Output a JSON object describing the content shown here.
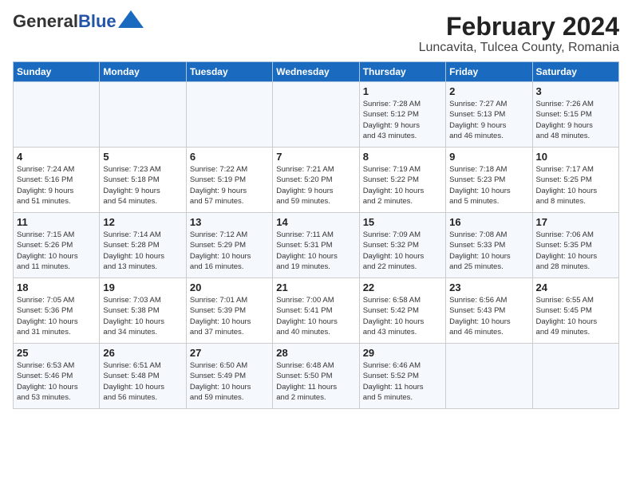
{
  "logo": {
    "general": "General",
    "blue": "Blue"
  },
  "title": "February 2024",
  "subtitle": "Luncavita, Tulcea County, Romania",
  "days_of_week": [
    "Sunday",
    "Monday",
    "Tuesday",
    "Wednesday",
    "Thursday",
    "Friday",
    "Saturday"
  ],
  "weeks": [
    [
      {
        "day": "",
        "info": ""
      },
      {
        "day": "",
        "info": ""
      },
      {
        "day": "",
        "info": ""
      },
      {
        "day": "",
        "info": ""
      },
      {
        "day": "1",
        "info": "Sunrise: 7:28 AM\nSunset: 5:12 PM\nDaylight: 9 hours\nand 43 minutes."
      },
      {
        "day": "2",
        "info": "Sunrise: 7:27 AM\nSunset: 5:13 PM\nDaylight: 9 hours\nand 46 minutes."
      },
      {
        "day": "3",
        "info": "Sunrise: 7:26 AM\nSunset: 5:15 PM\nDaylight: 9 hours\nand 48 minutes."
      }
    ],
    [
      {
        "day": "4",
        "info": "Sunrise: 7:24 AM\nSunset: 5:16 PM\nDaylight: 9 hours\nand 51 minutes."
      },
      {
        "day": "5",
        "info": "Sunrise: 7:23 AM\nSunset: 5:18 PM\nDaylight: 9 hours\nand 54 minutes."
      },
      {
        "day": "6",
        "info": "Sunrise: 7:22 AM\nSunset: 5:19 PM\nDaylight: 9 hours\nand 57 minutes."
      },
      {
        "day": "7",
        "info": "Sunrise: 7:21 AM\nSunset: 5:20 PM\nDaylight: 9 hours\nand 59 minutes."
      },
      {
        "day": "8",
        "info": "Sunrise: 7:19 AM\nSunset: 5:22 PM\nDaylight: 10 hours\nand 2 minutes."
      },
      {
        "day": "9",
        "info": "Sunrise: 7:18 AM\nSunset: 5:23 PM\nDaylight: 10 hours\nand 5 minutes."
      },
      {
        "day": "10",
        "info": "Sunrise: 7:17 AM\nSunset: 5:25 PM\nDaylight: 10 hours\nand 8 minutes."
      }
    ],
    [
      {
        "day": "11",
        "info": "Sunrise: 7:15 AM\nSunset: 5:26 PM\nDaylight: 10 hours\nand 11 minutes."
      },
      {
        "day": "12",
        "info": "Sunrise: 7:14 AM\nSunset: 5:28 PM\nDaylight: 10 hours\nand 13 minutes."
      },
      {
        "day": "13",
        "info": "Sunrise: 7:12 AM\nSunset: 5:29 PM\nDaylight: 10 hours\nand 16 minutes."
      },
      {
        "day": "14",
        "info": "Sunrise: 7:11 AM\nSunset: 5:31 PM\nDaylight: 10 hours\nand 19 minutes."
      },
      {
        "day": "15",
        "info": "Sunrise: 7:09 AM\nSunset: 5:32 PM\nDaylight: 10 hours\nand 22 minutes."
      },
      {
        "day": "16",
        "info": "Sunrise: 7:08 AM\nSunset: 5:33 PM\nDaylight: 10 hours\nand 25 minutes."
      },
      {
        "day": "17",
        "info": "Sunrise: 7:06 AM\nSunset: 5:35 PM\nDaylight: 10 hours\nand 28 minutes."
      }
    ],
    [
      {
        "day": "18",
        "info": "Sunrise: 7:05 AM\nSunset: 5:36 PM\nDaylight: 10 hours\nand 31 minutes."
      },
      {
        "day": "19",
        "info": "Sunrise: 7:03 AM\nSunset: 5:38 PM\nDaylight: 10 hours\nand 34 minutes."
      },
      {
        "day": "20",
        "info": "Sunrise: 7:01 AM\nSunset: 5:39 PM\nDaylight: 10 hours\nand 37 minutes."
      },
      {
        "day": "21",
        "info": "Sunrise: 7:00 AM\nSunset: 5:41 PM\nDaylight: 10 hours\nand 40 minutes."
      },
      {
        "day": "22",
        "info": "Sunrise: 6:58 AM\nSunset: 5:42 PM\nDaylight: 10 hours\nand 43 minutes."
      },
      {
        "day": "23",
        "info": "Sunrise: 6:56 AM\nSunset: 5:43 PM\nDaylight: 10 hours\nand 46 minutes."
      },
      {
        "day": "24",
        "info": "Sunrise: 6:55 AM\nSunset: 5:45 PM\nDaylight: 10 hours\nand 49 minutes."
      }
    ],
    [
      {
        "day": "25",
        "info": "Sunrise: 6:53 AM\nSunset: 5:46 PM\nDaylight: 10 hours\nand 53 minutes."
      },
      {
        "day": "26",
        "info": "Sunrise: 6:51 AM\nSunset: 5:48 PM\nDaylight: 10 hours\nand 56 minutes."
      },
      {
        "day": "27",
        "info": "Sunrise: 6:50 AM\nSunset: 5:49 PM\nDaylight: 10 hours\nand 59 minutes."
      },
      {
        "day": "28",
        "info": "Sunrise: 6:48 AM\nSunset: 5:50 PM\nDaylight: 11 hours\nand 2 minutes."
      },
      {
        "day": "29",
        "info": "Sunrise: 6:46 AM\nSunset: 5:52 PM\nDaylight: 11 hours\nand 5 minutes."
      },
      {
        "day": "",
        "info": ""
      },
      {
        "day": "",
        "info": ""
      }
    ]
  ]
}
